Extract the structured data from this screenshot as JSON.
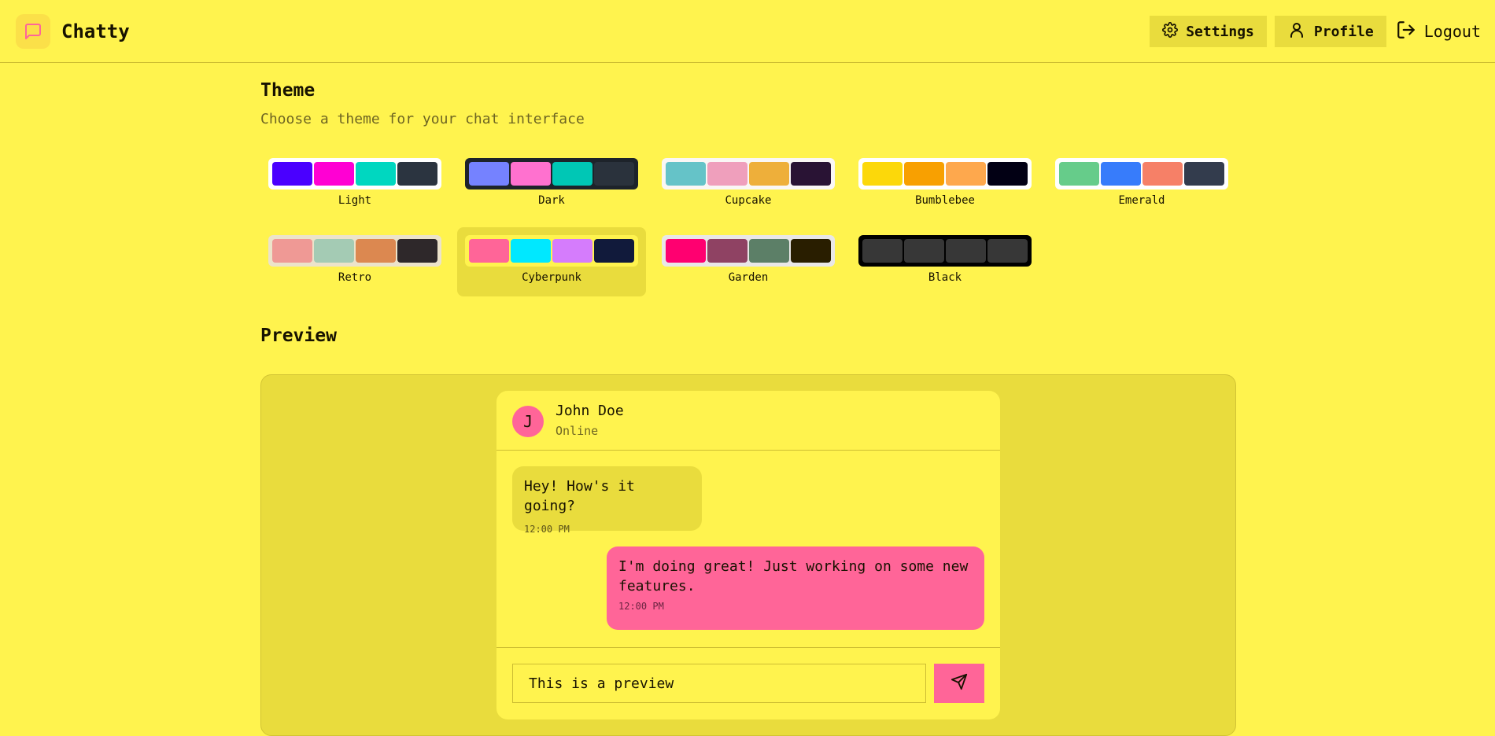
{
  "app": {
    "name": "Chatty",
    "icon": "message-square-icon"
  },
  "nav": {
    "settings_label": "Settings",
    "profile_label": "Profile",
    "logout_label": "Logout"
  },
  "theme_section": {
    "title": "Theme",
    "subtitle": "Choose a theme for your chat interface",
    "selected": "Cyberpunk",
    "themes": [
      {
        "name": "Light",
        "frame": "#ffffff",
        "colors": [
          "#4a00ff",
          "#ff00d3",
          "#00d7c0",
          "#2b3440"
        ]
      },
      {
        "name": "Dark",
        "frame": "#1d232a",
        "colors": [
          "#7582ff",
          "#ff71cf",
          "#00c7b5",
          "#2a323c"
        ]
      },
      {
        "name": "Cupcake",
        "frame": "#faf7f5",
        "colors": [
          "#65c3c8",
          "#ef9fbc",
          "#eeaf3a",
          "#291334"
        ]
      },
      {
        "name": "Bumblebee",
        "frame": "#ffffff",
        "colors": [
          "#fcd80a",
          "#f8a001",
          "#fea84d",
          "#020014"
        ]
      },
      {
        "name": "Emerald",
        "frame": "#ffffff",
        "colors": [
          "#66cc8a",
          "#377cfb",
          "#f68067",
          "#333c4d"
        ]
      },
      {
        "name": "Retro",
        "frame": "#ece3ca",
        "colors": [
          "#ef9995",
          "#a4cbb4",
          "#dc8850",
          "#2e282a"
        ]
      },
      {
        "name": "Cyberpunk",
        "frame": "#fff34e",
        "colors": [
          "#ff6598",
          "#00e8ff",
          "#d57cfc",
          "#111a3b"
        ]
      },
      {
        "name": "Garden",
        "frame": "#e9e7e7",
        "colors": [
          "#ff0070",
          "#8f4263",
          "#5c7f67",
          "#291e00"
        ]
      },
      {
        "name": "Black",
        "frame": "#000000",
        "colors": [
          "#373737",
          "#373737",
          "#373737",
          "#373737"
        ]
      }
    ]
  },
  "preview": {
    "title": "Preview",
    "contact": {
      "initial": "J",
      "name": "John Doe",
      "status": "Online"
    },
    "messages": [
      {
        "text": "Hey! How's it going?",
        "time": "12:00 PM",
        "sent": false
      },
      {
        "text": "I'm doing great! Just working on some new features.",
        "time": "12:00 PM",
        "sent": true
      }
    ],
    "input_value": "This is a preview"
  },
  "colors": {
    "background": "#fff34e",
    "surface": "#e9dc3d",
    "accent": "#ff6598",
    "border": "#cdbd32",
    "text": "#171200"
  }
}
